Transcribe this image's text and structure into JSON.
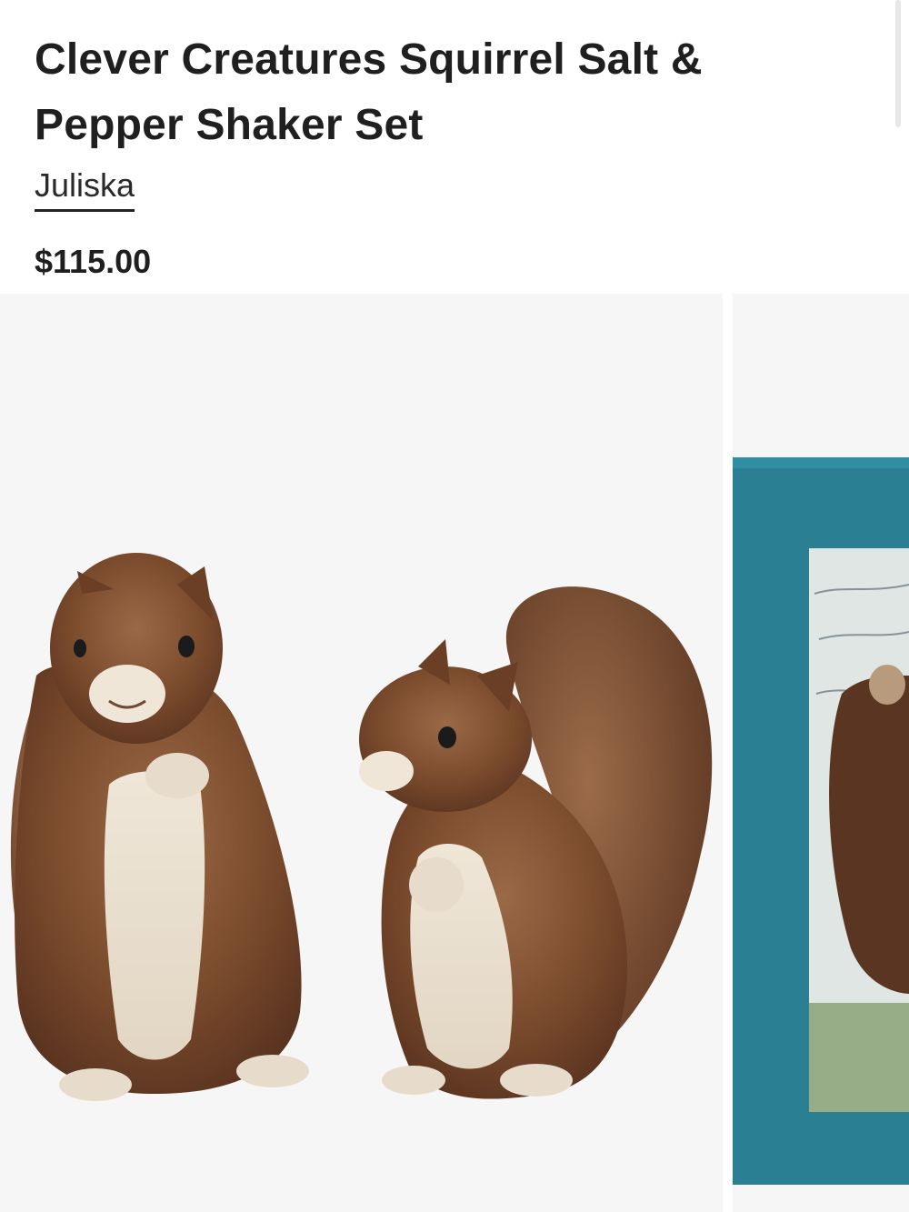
{
  "product": {
    "title": "Clever Creatures Squirrel Salt & Pepper Shaker Set",
    "brand": "Juliska",
    "price": "$115.00"
  },
  "gallery": {
    "images": [
      {
        "name": "squirrel-shakers-pair",
        "alt": "Two ceramic squirrel salt and pepper shakers"
      },
      {
        "name": "squirrel-shaker-in-box",
        "alt": "Squirrel shaker in teal gift box"
      }
    ]
  },
  "colors": {
    "text": "#1f1f1f",
    "image_bg": "#f6f6f6",
    "box_teal": "#2a7f93",
    "squirrel_brown": "#7a4a2c"
  }
}
